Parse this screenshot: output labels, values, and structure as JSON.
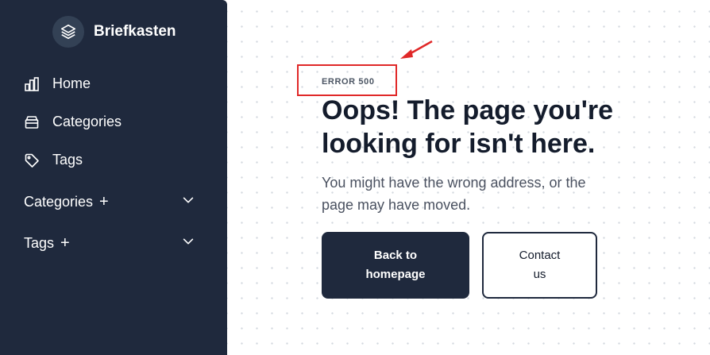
{
  "sidebar": {
    "brand": {
      "name": "Briefkasten",
      "icon": "layers-icon"
    },
    "nav": [
      {
        "label": "Home",
        "icon": "bar-chart-icon"
      },
      {
        "label": "Categories",
        "icon": "archive-icon"
      },
      {
        "label": "Tags",
        "icon": "tag-icon"
      }
    ],
    "groups": [
      {
        "label": "Categories",
        "plus": "+",
        "icon": "chevron-down-icon"
      },
      {
        "label": "Tags",
        "plus": "+",
        "icon": "chevron-down-icon"
      }
    ]
  },
  "main": {
    "error_code": "ERROR 500",
    "heading": "Oops! The page you're looking for isn't here.",
    "subtext": "You might have the wrong address, or the page may have moved.",
    "primary_button": "Back to homepage",
    "secondary_button": "Contact us"
  },
  "colors": {
    "sidebar_bg": "#1f293d",
    "highlight_box": "#e02828",
    "heading": "#141c2c"
  }
}
